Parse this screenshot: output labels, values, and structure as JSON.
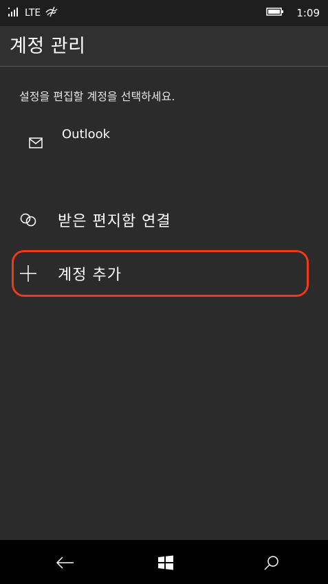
{
  "status_bar": {
    "network": "LTE",
    "time": "1:09"
  },
  "header": {
    "title": "계정 관리"
  },
  "main": {
    "instruction": "설정을 편집할 계정을 선택하세요.",
    "accounts": [
      {
        "name": "Outlook",
        "icon": "mail-icon"
      }
    ],
    "actions": [
      {
        "label": "받은 편지함 연결",
        "icon": "link-icon"
      },
      {
        "label": "계정 추가",
        "icon": "plus-icon"
      }
    ]
  },
  "nav_bar": {
    "buttons": [
      "back-icon",
      "windows-start-icon",
      "search-icon"
    ]
  },
  "colors": {
    "highlight": "#f03a17",
    "background": "#2b2b2b"
  }
}
